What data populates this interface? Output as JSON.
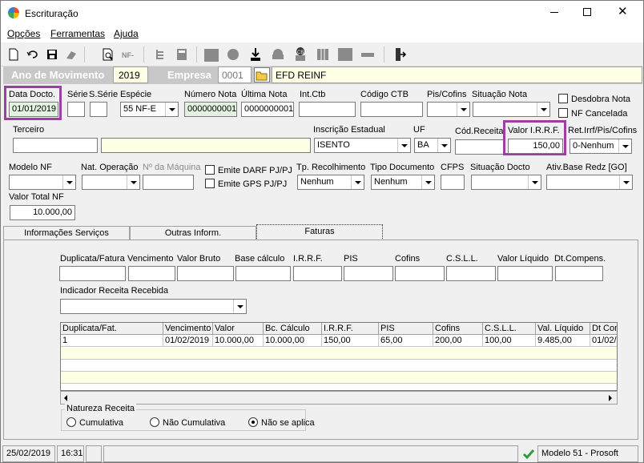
{
  "window": {
    "title": "Escrituração"
  },
  "menu": {
    "opcoes": "Opções",
    "ferramentas": "Ferramentas",
    "ajuda": "Ajuda"
  },
  "header": {
    "ano_label": "Ano de Movimento",
    "ano_value": "2019",
    "empresa_label": "Empresa",
    "empresa_code": "0001",
    "empresa_name": "EFD REINF"
  },
  "row1": {
    "data_docto_label": "Data Docto.",
    "data_docto_value": "01/01/2019",
    "serie_label": "Série",
    "serie_value": "",
    "sserie_label": "S.Série",
    "sserie_value": "",
    "especie_label": "Espécie",
    "especie_value": "55 NF-E",
    "numero_nota_label": "Número Nota",
    "numero_nota_value": "0000000001",
    "ultima_nota_label": "Última Nota",
    "ultima_nota_value": "0000000001",
    "int_ctb_label": "Int.Ctb",
    "codigo_ctb_label": "Código CTB",
    "pis_cofins_label": "Pis/Cofins",
    "situacao_nota_label": "Situação Nota",
    "desdobra_nota_label": "Desdobra Nota",
    "nf_cancelada_label": "NF Cancelada"
  },
  "row2": {
    "terceiro_label": "Terceiro",
    "inscricao_label": "Inscrição Estadual",
    "inscricao_value": "ISENTO",
    "uf_label": "UF",
    "uf_value": "BA",
    "cod_receita_label": "Cód.Receita",
    "valor_irrf_label": "Valor I.R.R.F.",
    "valor_irrf_value": "150,00",
    "ret_label": "Ret.Irrf/Pis/Cofins",
    "ret_value": "0-Nenhum"
  },
  "row3": {
    "modelo_nf_label": "Modelo NF",
    "nat_operacao_label": "Nat. Operação",
    "num_maquina_label": "Nº da Máquina",
    "emite_darf_label": "Emite DARF PJ/PJ",
    "emite_gps_label": "Emite GPS PJ/PJ",
    "tp_recolhimento_label": "Tp. Recolhimento",
    "tp_recolhimento_value": "Nenhum",
    "tipo_documento_label": "Tipo Documento",
    "tipo_documento_value": "Nenhum",
    "cfps_label": "CFPS",
    "situacao_docto_label": "Situação Docto",
    "ativ_base_label": "Ativ.Base Redz [GO]"
  },
  "row4": {
    "valor_total_label": "Valor Total NF",
    "valor_total_value": "10.000,00"
  },
  "tabs": [
    "Informações Serviços",
    "Outras Inform.",
    "Faturas"
  ],
  "faturas": {
    "fields": [
      "Duplicata/Fatura",
      "Vencimento",
      "Valor Bruto",
      "Base cálculo",
      "I.R.R.F.",
      "PIS",
      "Cofins",
      "C.S.L.L.",
      "Valor Líquido",
      "Dt.Compens."
    ],
    "indicador_label": "Indicador Receita Recebida",
    "grid_headers": [
      "Duplicata/Fat.",
      "Vencimento",
      "Valor",
      "Bc. Cálculo",
      "I.R.R.F.",
      "PIS",
      "Cofins",
      "C.S.L.L.",
      "Val. Líquido",
      "Dt Com"
    ],
    "grid_rows": [
      [
        "1",
        "01/02/2019",
        "10.000,00",
        "10.000,00",
        "150,00",
        "65,00",
        "200,00",
        "100,00",
        "9.485,00",
        "01/02/"
      ]
    ],
    "natureza_label": "Natureza Receita",
    "natureza_options": [
      "Cumulativa",
      "Não Cumulativa",
      "Não se aplica"
    ]
  },
  "status": {
    "date": "25/02/2019",
    "time": "16:31",
    "model": "Modelo 51 - Prosoft"
  },
  "colors": {
    "accent_highlight": "#9b3fa0",
    "header_bar": "#c8c8c8",
    "readonly_yellow": "#ffffe6",
    "green_field": "#e2f4e0"
  }
}
